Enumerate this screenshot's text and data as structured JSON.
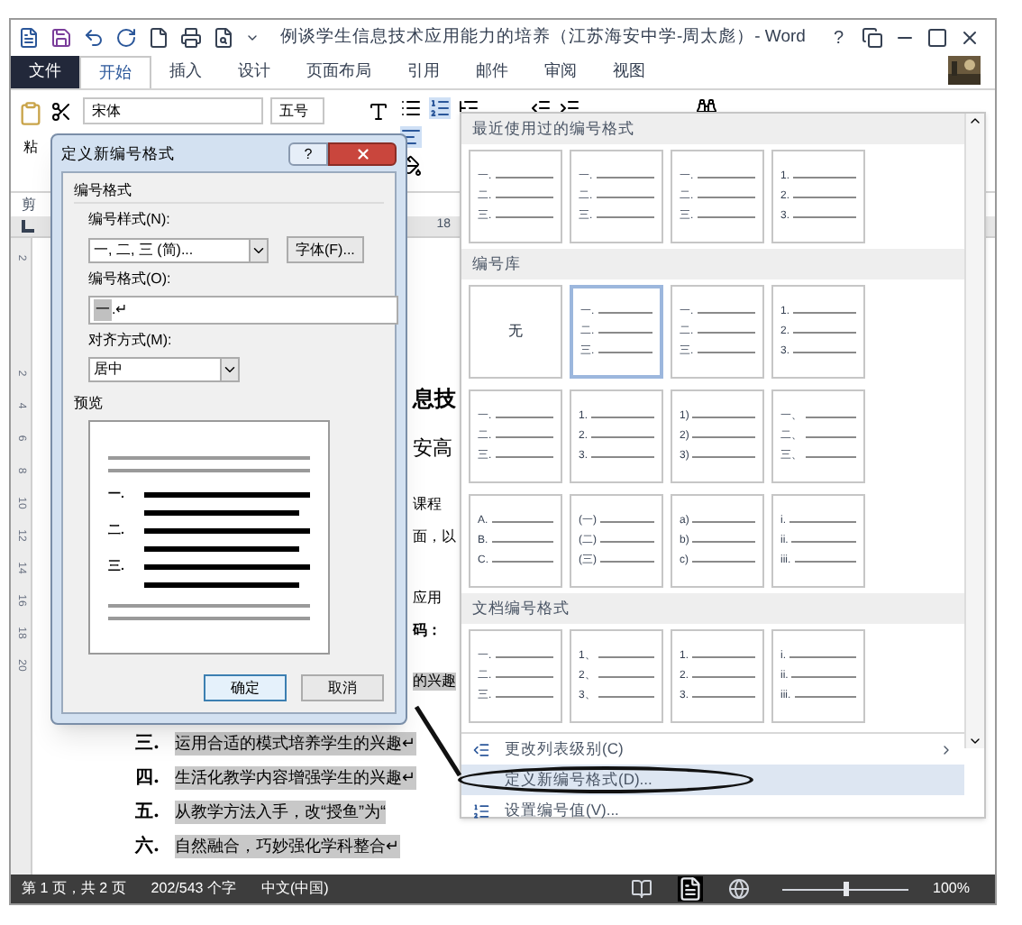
{
  "title_bar": {
    "title": "例谈学生信息技术应用能力的培养（江苏海安中学-周太彪）- Word",
    "help": "?"
  },
  "tabs": [
    {
      "label": "文件",
      "kind": "file",
      "selected": false
    },
    {
      "label": "开始",
      "kind": "tab",
      "selected": true
    },
    {
      "label": "插入",
      "kind": "tab",
      "selected": false
    },
    {
      "label": "设计",
      "kind": "tab",
      "selected": false
    },
    {
      "label": "页面布局",
      "kind": "tab",
      "selected": false
    },
    {
      "label": "引用",
      "kind": "tab",
      "selected": false
    },
    {
      "label": "邮件",
      "kind": "tab",
      "selected": false
    },
    {
      "label": "审阅",
      "kind": "tab",
      "selected": false
    },
    {
      "label": "视图",
      "kind": "tab",
      "selected": false
    }
  ],
  "ribbon": {
    "paste_label": "粘",
    "font_name": "宋体",
    "font_size": "五号",
    "clipboard_group_label": "剪",
    "ruler_number": "18"
  },
  "vertical_ruler": [
    "2",
    "2",
    "4",
    "6",
    "8",
    "10",
    "12",
    "14",
    "16",
    "18",
    "20"
  ],
  "document": {
    "fragments": [
      {
        "text": "息技",
        "kind": "heading",
        "highlighted": false
      },
      {
        "text": "安高",
        "kind": "subtitle",
        "highlighted": false
      },
      {
        "text": "课程",
        "kind": "body",
        "highlighted": false
      },
      {
        "text": "面，以",
        "kind": "body",
        "highlighted": false
      },
      {
        "text": "应用",
        "kind": "body",
        "highlighted": false
      },
      {
        "text": "码：",
        "kind": "bold",
        "highlighted": false
      },
      {
        "text": "的兴趣",
        "kind": "body",
        "highlighted": true
      }
    ],
    "list": [
      {
        "number": "三.",
        "text": "运用合适的模式培养学生的兴趣↵",
        "highlighted": true
      },
      {
        "number": "四.",
        "text": "生活化教学内容增强学生的兴趣↵",
        "highlighted": true
      },
      {
        "number": "五.",
        "text": "从教学方法入手，改“授鱼”为“",
        "highlighted": true
      },
      {
        "number": "六.",
        "text": "自然融合，巧妙强化学科整合↵",
        "highlighted": true
      }
    ]
  },
  "dialog": {
    "title": "定义新编号格式",
    "help": "?",
    "section_label": "编号格式",
    "style_label": "编号样式(N):",
    "style_value": "一, 二, 三 (简)...",
    "font_button": "字体(F)...",
    "format_label": "编号格式(O):",
    "format_number": "一",
    "format_suffix": ".↵",
    "align_label": "对齐方式(M):",
    "align_value": "居中",
    "preview_label": "预览",
    "preview_labels": [
      "一.",
      "二.",
      "三."
    ],
    "ok": "确定",
    "cancel": "取消"
  },
  "gallery": {
    "sections": [
      {
        "title": "最近使用过的编号格式",
        "items": [
          {
            "kind": "list",
            "labels": [
              "一.",
              "二.",
              "三."
            ],
            "selected": false
          },
          {
            "kind": "list",
            "labels": [
              "一.",
              "二.",
              "三."
            ],
            "selected": false
          },
          {
            "kind": "list",
            "labels": [
              "一.",
              "二.",
              "三."
            ],
            "selected": false
          },
          {
            "kind": "list",
            "labels": [
              "1.",
              "2.",
              "3."
            ],
            "selected": false
          }
        ]
      },
      {
        "title": "编号库",
        "items": [
          {
            "kind": "none",
            "label": "无",
            "selected": false
          },
          {
            "kind": "list",
            "labels": [
              "一.",
              "二.",
              "三."
            ],
            "selected": true
          },
          {
            "kind": "list",
            "labels": [
              "一.",
              "二.",
              "三."
            ],
            "selected": false
          },
          {
            "kind": "list",
            "labels": [
              "1.",
              "2.",
              "3."
            ],
            "selected": false
          },
          {
            "kind": "list",
            "labels": [
              "一.",
              "二.",
              "三."
            ],
            "selected": false
          },
          {
            "kind": "list",
            "labels": [
              "1.",
              "2.",
              "3."
            ],
            "selected": false
          },
          {
            "kind": "list",
            "labels": [
              "1)",
              "2)",
              "3)"
            ],
            "selected": false
          },
          {
            "kind": "list",
            "labels": [
              "一、",
              "二、",
              "三、"
            ],
            "selected": false
          },
          {
            "kind": "list",
            "labels": [
              "A.",
              "B.",
              "C."
            ],
            "selected": false
          },
          {
            "kind": "list",
            "labels": [
              "(一)",
              "(二)",
              "(三)"
            ],
            "selected": false
          },
          {
            "kind": "list",
            "labels": [
              "a)",
              "b)",
              "c)"
            ],
            "selected": false
          },
          {
            "kind": "list",
            "labels": [
              "i.",
              "ii.",
              "iii."
            ],
            "selected": false
          }
        ]
      },
      {
        "title": "文档编号格式",
        "items": [
          {
            "kind": "list",
            "labels": [
              "一.",
              "二.",
              "三."
            ],
            "selected": false
          },
          {
            "kind": "list",
            "labels": [
              "1、",
              "2、",
              "3、"
            ],
            "selected": false
          },
          {
            "kind": "list",
            "labels": [
              "1.",
              "2.",
              "3."
            ],
            "selected": false
          },
          {
            "kind": "list",
            "labels": [
              "i.",
              "ii.",
              "iii."
            ],
            "selected": false
          }
        ]
      }
    ],
    "menu": [
      {
        "label": "更改列表级别(C)",
        "kind": "level",
        "submenu": true,
        "selected": false
      },
      {
        "label": "定义新编号格式(D)...",
        "kind": "define",
        "submenu": false,
        "selected": true
      },
      {
        "label": "设置编号值(V)...",
        "kind": "value",
        "submenu": false,
        "selected": false
      }
    ]
  },
  "status_bar": {
    "page": "第 1 页，共 2 页",
    "words": "202/543 个字",
    "language": "中文(中国)",
    "zoom_slider": {
      "level": 0.5
    },
    "zoom": "100%"
  }
}
